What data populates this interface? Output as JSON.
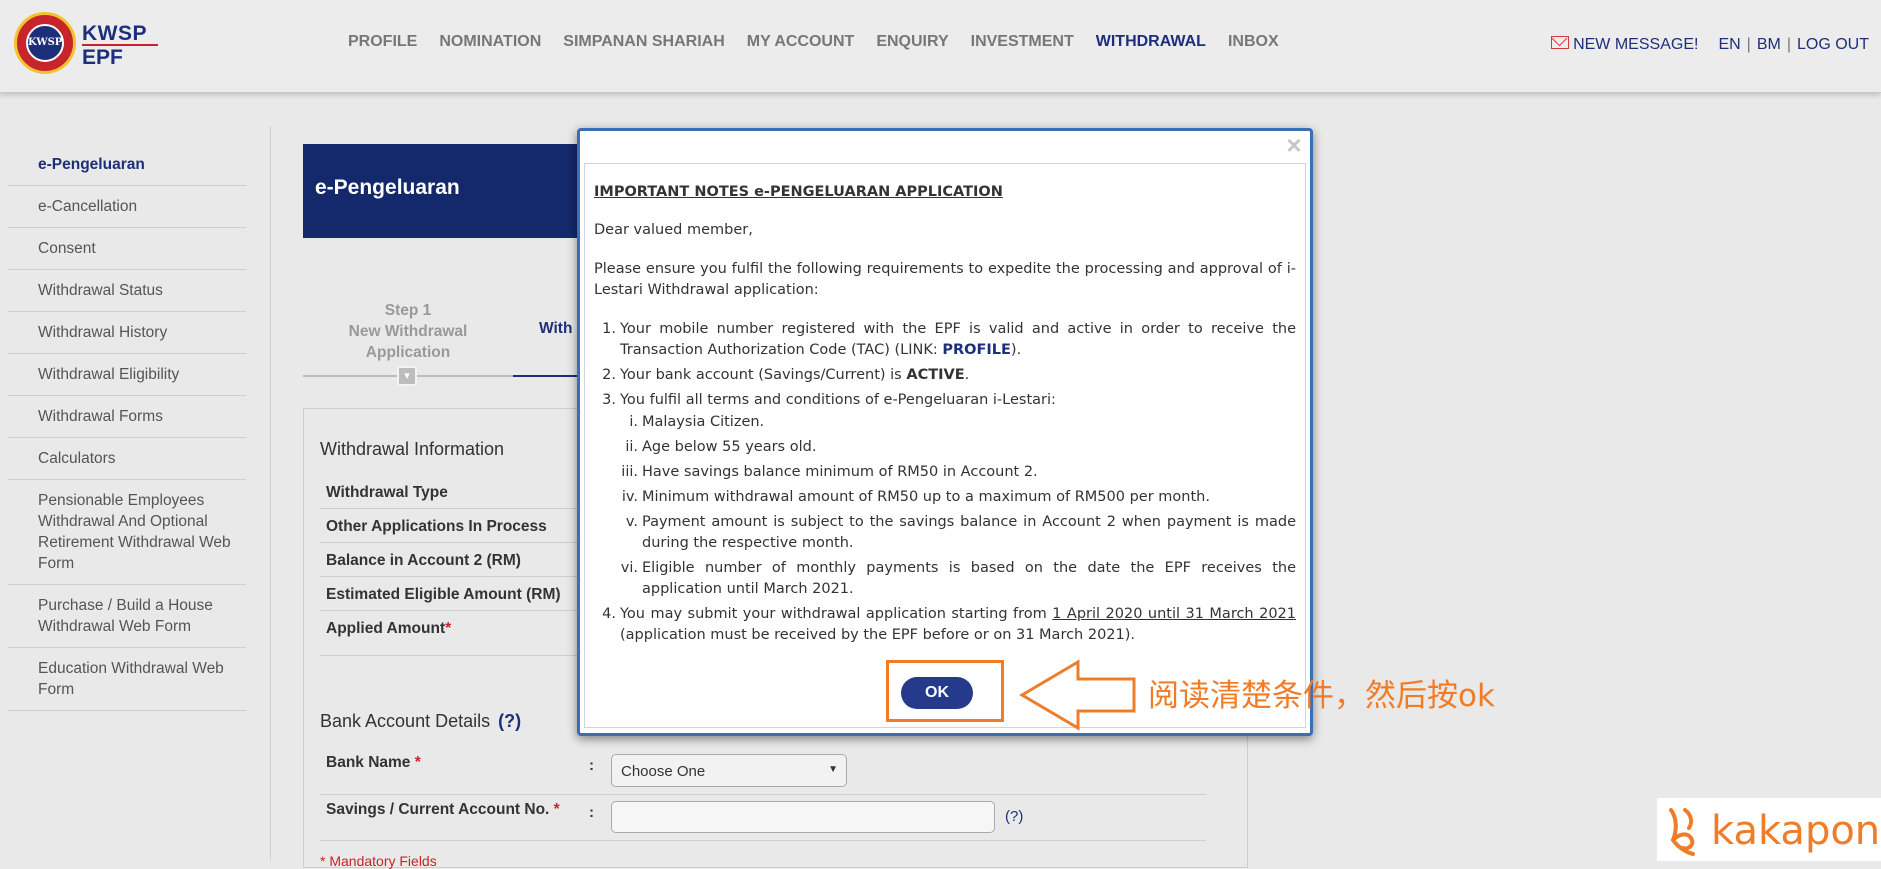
{
  "header": {
    "logo": {
      "kwsp": "KWSP",
      "epf": "EPF",
      "seal": "KWSP"
    },
    "nav": [
      "PROFILE",
      "NOMINATION",
      "SIMPANAN SHARIAH",
      "MY ACCOUNT",
      "ENQUIRY",
      "INVESTMENT",
      "WITHDRAWAL",
      "INBOX"
    ],
    "active_nav": "WITHDRAWAL",
    "new_message": "NEW MESSAGE!",
    "lang_en": "EN",
    "lang_bm": "BM",
    "logout": "LOG OUT",
    "separator": "|"
  },
  "sidebar": {
    "items": [
      "e-Pengeluaran",
      "e-Cancellation",
      "Consent",
      "Withdrawal Status",
      "Withdrawal History",
      "Withdrawal Eligibility",
      "Withdrawal Forms",
      "Calculators",
      "Pensionable Employees Withdrawal And Optional Retirement Withdrawal Web Form",
      "Purchase / Build a House Withdrawal Web Form",
      "Education Withdrawal Web Form"
    ]
  },
  "main": {
    "banner_title": "e-Pengeluaran",
    "step1": {
      "line1": "Step 1",
      "line2": "New Withdrawal",
      "line3": "Application"
    },
    "step2_partial": "With",
    "withdrawal_info": {
      "title": "Withdrawal Information",
      "rows": [
        "Withdrawal Type",
        "Other Applications In Process",
        "Balance in Account 2 (RM)",
        "Estimated Eligible Amount (RM)",
        "Applied Amount"
      ],
      "required_mark": "*"
    },
    "bank": {
      "title": "Bank Account Details",
      "help": "(?)",
      "bank_name_label": "Bank Name",
      "bank_select_value": "Choose One",
      "account_label": "Savings / Current Account No.",
      "account_help": "(?)",
      "colon": ":",
      "required_mark": "*",
      "mandatory": "* Mandatory Fields"
    }
  },
  "modal": {
    "close": "×",
    "title": "IMPORTANT NOTES e-PENGELUARAN APPLICATION",
    "greeting": "Dear valued member,",
    "intro": "Please ensure you fulfil the following requirements to expedite the processing and approval of i-Lestari Withdrawal application:",
    "item1_text": "Your mobile number registered with the EPF is valid and active in order to receive the Transaction Authorization Code (TAC) (LINK: ",
    "item1_link": "PROFILE",
    "item1_end": ").",
    "item2_text": "Your bank account (Savings/Current) is ",
    "item2_bold": "ACTIVE",
    "item2_end": ".",
    "item3_text": "You fulfil all terms and conditions of e-Pengeluaran i-Lestari:",
    "sub_items": [
      {
        "num": "i.",
        "text": "Malaysia Citizen."
      },
      {
        "num": "ii.",
        "text": "Age below 55 years old."
      },
      {
        "num": "iii.",
        "text": "Have savings balance minimum of RM50 in Account 2."
      },
      {
        "num": "iv.",
        "text": "Minimum withdrawal amount of RM50 up to a maximum of RM500 per month."
      },
      {
        "num": "v.",
        "text": "Payment amount is subject to the savings balance in Account 2 when payment is made during the respective month."
      },
      {
        "num": "vi.",
        "text": "Eligible number of monthly payments is based on the date the EPF receives the application until March 2021."
      }
    ],
    "item4_text": "You may submit your withdrawal application starting from ",
    "item4_date": "1 April 2020 until 31 March 2021",
    "item4_end": " (application must be received by the EPF before or on 31 March 2021).",
    "nums": [
      "1.",
      "2.",
      "3.",
      "4."
    ],
    "ok_label": "OK"
  },
  "annotation": {
    "text": "阅读清楚条件，然后按ok",
    "color": "#f07c28"
  },
  "watermark": {
    "text": "kakapon"
  },
  "colors": {
    "brand_navy": "#1d2f7a",
    "brand_red": "#c8242b",
    "accent_orange": "#f07c28",
    "modal_border": "#3a6fb5"
  }
}
